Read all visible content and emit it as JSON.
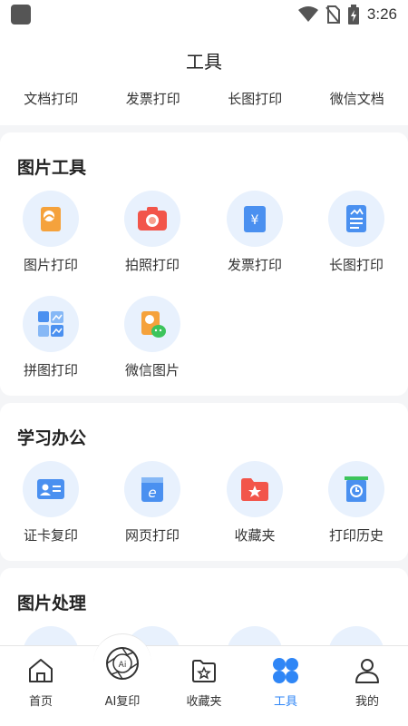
{
  "status": {
    "time": "3:26"
  },
  "header": {
    "title": "工具",
    "quick_tabs": [
      "文档打印",
      "发票打印",
      "长图打印",
      "微信文档"
    ]
  },
  "sections": [
    {
      "title": "图片工具",
      "tools": [
        {
          "label": "图片打印",
          "icon": "photo-print-icon"
        },
        {
          "label": "拍照打印",
          "icon": "camera-icon"
        },
        {
          "label": "发票打印",
          "icon": "invoice-icon"
        },
        {
          "label": "长图打印",
          "icon": "long-image-icon"
        },
        {
          "label": "拼图打印",
          "icon": "collage-icon"
        },
        {
          "label": "微信图片",
          "icon": "wechat-image-icon"
        }
      ]
    },
    {
      "title": "学习办公",
      "tools": [
        {
          "label": "证卡复印",
          "icon": "id-card-icon"
        },
        {
          "label": "网页打印",
          "icon": "web-page-icon"
        },
        {
          "label": "收藏夹",
          "icon": "favorites-folder-icon"
        },
        {
          "label": "打印历史",
          "icon": "print-history-icon"
        }
      ]
    },
    {
      "title": "图片处理",
      "tools": []
    }
  ],
  "tabbar": {
    "items": [
      {
        "label": "首页",
        "icon": "home-icon"
      },
      {
        "label": "AI复印",
        "icon": "ai-aperture-icon"
      },
      {
        "label": "收藏夹",
        "icon": "star-folder-icon"
      },
      {
        "label": "工具",
        "icon": "tools-grid-icon"
      },
      {
        "label": "我的",
        "icon": "profile-icon"
      }
    ],
    "active_index": 3
  },
  "colors": {
    "accent": "#2f86f6",
    "icon_bg": "#e8f1fd",
    "orange": "#f5a23c",
    "red": "#f2554a",
    "blue": "#4a90f0"
  }
}
